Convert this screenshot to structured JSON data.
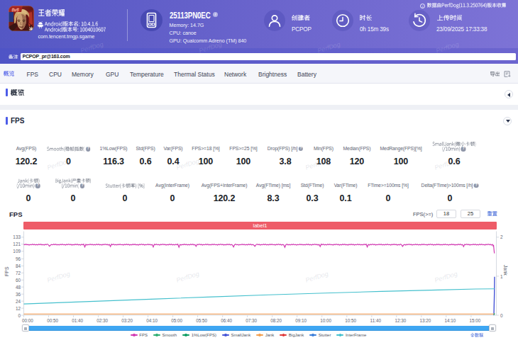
{
  "header": {
    "app_title": "王者荣耀",
    "android_version_name": "Android版本名: 10.4.1.6",
    "android_version_code": "Android版本号: 1004010607",
    "package_name": "com.tencent.tmgp.sgame",
    "device_name": "25113PN0EC",
    "memory": "Memory: 14.7G",
    "cpu": "CPU: canoe",
    "gpu": "GPU: Qualcomm Adreno (TM) 840",
    "creator_label": "创建者",
    "creator_value": "PCPOP",
    "duration_label": "时长",
    "duration_value": "0h 15m 39s",
    "upload_label": "上传时间",
    "upload_value": "23/09/2025 17:33:38",
    "collect_info": "数据由PerfDog(11.3.250764)版本收集"
  },
  "note": {
    "label": "备注:",
    "value": "PCPOP_pr@163.com"
  },
  "icons": {
    "info": "i",
    "help": "?"
  },
  "tabs": {
    "items": [
      "概览",
      "FPS",
      "CPU",
      "Memory",
      "GPU",
      "Temperature",
      "Thermal Status",
      "Network",
      "Brightness",
      "Battery"
    ],
    "active": "概览",
    "export_label": "导出"
  },
  "sections": {
    "overview_title": "概览",
    "fps_title": "FPS"
  },
  "stats": {
    "row1": [
      {
        "label": "Avg(FPS)",
        "value": "120.2"
      },
      {
        "label": "Smooth(稳帧指数)",
        "help": true,
        "value": "0"
      },
      {
        "label": "1%Low(FPS)",
        "value": "116.3"
      },
      {
        "label": "Std(FPS)",
        "value": "0.6"
      },
      {
        "label": "Var(FPS)",
        "value": "0.4"
      },
      {
        "label": "FPS>=18 [%]",
        "value": "100"
      },
      {
        "label": "FPS>=25 [%]",
        "value": "100"
      },
      {
        "label": "Drop(FPS) [/h]",
        "help": true,
        "value": "3.8"
      },
      {
        "label": "Min(FPS)",
        "value": "108"
      },
      {
        "label": "Median(FPS)",
        "value": "120"
      },
      {
        "label": "MedRange(FPS)[%]",
        "value": "100"
      },
      {
        "label": "SmallJank(微小卡顿)",
        "label2": "(/10min)",
        "help": true,
        "value": "0.6"
      }
    ],
    "row2": [
      {
        "label": "Jank(卡顿)",
        "label2": "(/10min)",
        "help": true,
        "value": "0"
      },
      {
        "label": "BigJank(严重卡顿)",
        "label2": "(/10min)",
        "help": true,
        "value": "0"
      },
      {
        "label": "Stutter(卡顿率) [%]",
        "value": "0"
      },
      {
        "label": "Avg(InterFrame)",
        "value": "0"
      },
      {
        "label": "Avg(FPS+InterFrame)",
        "value": "120.2"
      },
      {
        "label": "Avg(FTime) [ms]",
        "value": "8.3"
      },
      {
        "label": "Std(FTime)",
        "value": "0.3"
      },
      {
        "label": "Var(FTime)",
        "value": "0.1"
      },
      {
        "label": "FTime>=100ms [%]",
        "value": "0"
      },
      {
        "label": "Delta(FTime)>100ms [/h]",
        "help": true,
        "value": "0"
      }
    ]
  },
  "fps_chart_header": {
    "title": "FPS",
    "filter_label": "FPS(>=)",
    "filter_value1": "18",
    "filter_value2": "25",
    "reset_label": "重置"
  },
  "chart_data": {
    "type": "line",
    "title": "FPS",
    "annotation_label": "label1",
    "ylabel_left": "FPS",
    "ylabel_right": "Jank",
    "y_left_ticks": [
      133,
      121,
      109,
      96,
      84,
      72,
      60,
      48,
      36,
      24,
      12,
      0
    ],
    "y_right_ticks": [
      2,
      1,
      0
    ],
    "y_left_max": 133,
    "y_right_max": 2,
    "x_labels": [
      "00:00",
      "00:50",
      "01:40",
      "02:30",
      "03:20",
      "04:10",
      "05:00",
      "05:50",
      "06:40",
      "07:30",
      "08:20",
      "09:10",
      "10:00",
      "10:50",
      "11:40",
      "12:30",
      "13:20",
      "14:10",
      "15:00"
    ],
    "series": [
      {
        "name": "FPS",
        "color": "#d13ab2",
        "axis": "left",
        "kind": "fps",
        "base": 120.3,
        "dips": [
          [
            0.055,
            117.5
          ],
          [
            0.13,
            116.2
          ],
          [
            0.185,
            117
          ],
          [
            0.275,
            116.3
          ],
          [
            0.33,
            115.8
          ],
          [
            0.365,
            117.3
          ],
          [
            0.445,
            116.3
          ],
          [
            0.49,
            117.4
          ],
          [
            0.555,
            115.6
          ],
          [
            0.63,
            117
          ],
          [
            0.73,
            116.3
          ],
          [
            0.805,
            117.2
          ],
          [
            0.935,
            116.8
          ]
        ],
        "end": [
          [
            0.9975,
            117
          ],
          [
            0.999,
            110
          ],
          [
            0.9995,
            105.5
          ]
        ]
      },
      {
        "name": "Smooth",
        "color": "#2fae71",
        "axis": "left",
        "kind": "none"
      },
      {
        "name": "1%Low(FPS)",
        "color": "#0f9d62",
        "axis": "left",
        "kind": "none"
      },
      {
        "name": "SmallJank",
        "color": "#4553d6",
        "axis": "right",
        "kind": "spike",
        "points": [
          [
            0.9985,
            0.0
          ],
          [
            0.9995,
            0.55
          ],
          [
            1.0,
            0.985
          ]
        ]
      },
      {
        "name": "Jank",
        "color": "#f3a869",
        "axis": "right",
        "kind": "flat",
        "value": 0.03
      },
      {
        "name": "BigJank",
        "color": "#df3a3a",
        "axis": "right",
        "kind": "none"
      },
      {
        "name": "Stutter",
        "color": "#3d7fd9",
        "axis": "right",
        "kind": "none"
      },
      {
        "name": "InterFrame",
        "color": "#45c0cd",
        "axis": "left",
        "kind": "curve",
        "points": [
          [
            0,
            19.2
          ],
          [
            0.08,
            21.6
          ],
          [
            0.17,
            24.2
          ],
          [
            0.28,
            27.6
          ],
          [
            0.4,
            31.2
          ],
          [
            0.52,
            34.6
          ],
          [
            0.64,
            37.8
          ],
          [
            0.76,
            40.6
          ],
          [
            0.88,
            43.0
          ],
          [
            0.96,
            44.6
          ],
          [
            1,
            45.0
          ]
        ]
      }
    ],
    "legend": [
      "FPS",
      "Smooth",
      "1%Low(FPS)",
      "SmallJank",
      "Jank",
      "BigJank",
      "Stutter",
      "InterFrame"
    ],
    "full_data_label": "全数据",
    "watermark": "PerfDog"
  }
}
